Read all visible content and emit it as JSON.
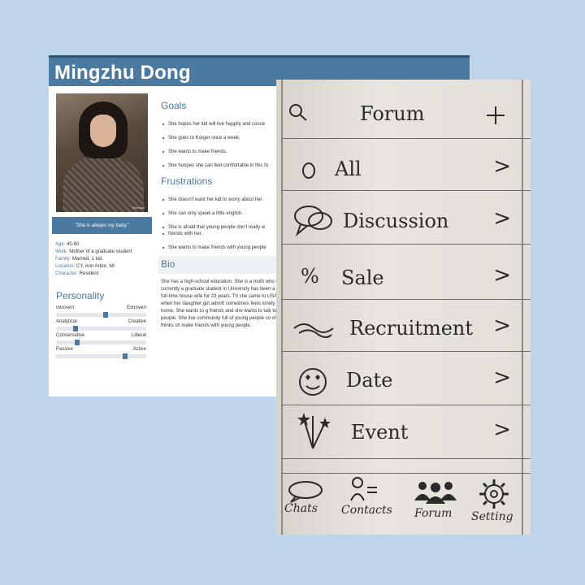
{
  "persona": {
    "name": "Mingzhu Dong",
    "quote": "\"She is always my baby.\"",
    "photo_watermark": "SheSaid",
    "facts": [
      {
        "key": "Age:",
        "value": " 40-60"
      },
      {
        "key": "Work:",
        "value": " Mother of a graduate student"
      },
      {
        "key": "Family:",
        "value": " Married, 1 kid."
      },
      {
        "key": "Location:",
        "value": " CY, Ann Arbor, MI"
      },
      {
        "key": "Character:",
        "value": " Resident"
      }
    ],
    "personality_title": "Personality",
    "personality": [
      {
        "left": "Introvert",
        "right": "Extrovert",
        "level": 0.55
      },
      {
        "left": "Analytical",
        "right": "Creative",
        "level": 0.2
      },
      {
        "left": "Conservative",
        "right": "Liberal",
        "level": 0.22
      },
      {
        "left": "Passive",
        "right": "Active",
        "level": 0.78
      }
    ],
    "goals_title": "Goals",
    "goals": [
      "She hopes her kid will live happily and conce",
      "She goes to Korger once a week.",
      "She wants to make friends.",
      "She hoopes she can feel comfortable in this fo"
    ],
    "frustrations_title": "Frustrations",
    "frustrations": [
      "She doesn't want her kid to worry about her.",
      "She can only speak a little english.",
      "She is afraid that young people don't really w",
      "friends with her.",
      "She wants to make friends with young people"
    ],
    "bio_title": "Bio",
    "bio": "She has a high-school education. She is a moth who is currently a graduate student in University has been a full-time house wife for 23 years. Th she came to USA when her daughter got admitt sometimes feels lonely at home. She wants to g friends and she wants to talk to people. She live community full of young people so she thinks sh make friends with young people."
  },
  "sketch": {
    "title": "Forum",
    "search_icon": "search-icon",
    "add_icon": "plus-icon",
    "menu": [
      {
        "label": "All",
        "icon": "circle-icon",
        "arrow": ">"
      },
      {
        "label": "Discussion",
        "icon": "speech-bubbles-icon",
        "arrow": ">"
      },
      {
        "label": "Sale",
        "icon": "percent-icon",
        "arrow": ">"
      },
      {
        "label": "Recruitment",
        "icon": "handshake-icon",
        "arrow": ">"
      },
      {
        "label": "Date",
        "icon": "heart-eyes-emoji-icon",
        "arrow": ">"
      },
      {
        "label": "Event",
        "icon": "fireworks-icon",
        "arrow": ">"
      }
    ],
    "tabs": [
      {
        "label": "Chats",
        "icon": "chat-bubble-icon"
      },
      {
        "label": "Contacts",
        "icon": "contacts-icon"
      },
      {
        "label": "Forum",
        "icon": "group-icon"
      },
      {
        "label": "Setting",
        "icon": "gear-icon"
      }
    ]
  },
  "colors": {
    "background": "#bdd4ea",
    "persona_accent": "#4b7aa1",
    "paper": "#e4e0db"
  }
}
